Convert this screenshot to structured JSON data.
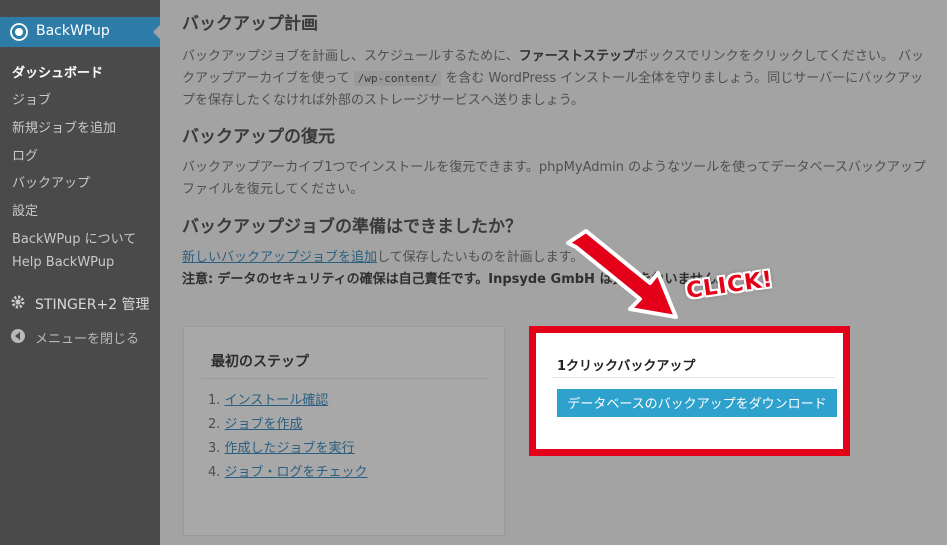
{
  "sidebar": {
    "plugin_title": "BackWPup",
    "items": [
      {
        "label": "ダッシュボード",
        "current": true
      },
      {
        "label": "ジョブ"
      },
      {
        "label": "新規ジョブを追加"
      },
      {
        "label": "ログ"
      },
      {
        "label": "バックアップ"
      },
      {
        "label": "設定"
      },
      {
        "label": "BackWPup について"
      },
      {
        "label": "Help BackWPup"
      }
    ],
    "stinger_label": "STINGER+2 管理",
    "collapse_label": "メニューを閉じる"
  },
  "sections": {
    "plan_title": "バックアップ計画",
    "plan_text_1": "バックアップジョブを計画し、スケジュールするために、",
    "plan_text_bold": "ファーストステップ",
    "plan_text_2": "ボックスでリンクをクリックしてください。 バックアップアーカイブを使って",
    "plan_code": "/wp-content/",
    "plan_text_3": "を含む WordPress インストール全体を守りましょう。同じサーバーにバックアップを保存したくなければ外部のストレージサービスへ送りましょう。",
    "restore_title": "バックアップの復元",
    "restore_text": "バックアップアーカイブ1つでインストールを復元できます。phpMyAdmin のようなツールを使ってデータベースバックアップファイルを復元してください。",
    "ready_title": "バックアップジョブの準備はできましたか？",
    "ready_link": "新しいバックアップジョブを追加",
    "ready_text": "して保存したいものを計画します。",
    "ready_note_label": "注意:",
    "ready_note_text": "データのセキュリティの確保は自己責任です。Inpsyde GmbH は責任を負いません。"
  },
  "first_steps": {
    "title": "最初のステップ",
    "steps": [
      {
        "num": "1.",
        "label": "インストール確認"
      },
      {
        "num": "2.",
        "label": "ジョブを作成"
      },
      {
        "num": "3.",
        "label": "作成したジョブを実行"
      },
      {
        "num": "4.",
        "label": "ジョブ・ログをチェック"
      }
    ]
  },
  "one_click": {
    "title": "1クリックバックアップ",
    "button_label": "データベースのバックアップをダウンロード"
  },
  "annotation": {
    "click_text": "CLICK!"
  },
  "colors": {
    "sidebar_active": "#2e7ca8",
    "highlight_red": "#e5001a",
    "button_blue": "#2ea2cc"
  }
}
